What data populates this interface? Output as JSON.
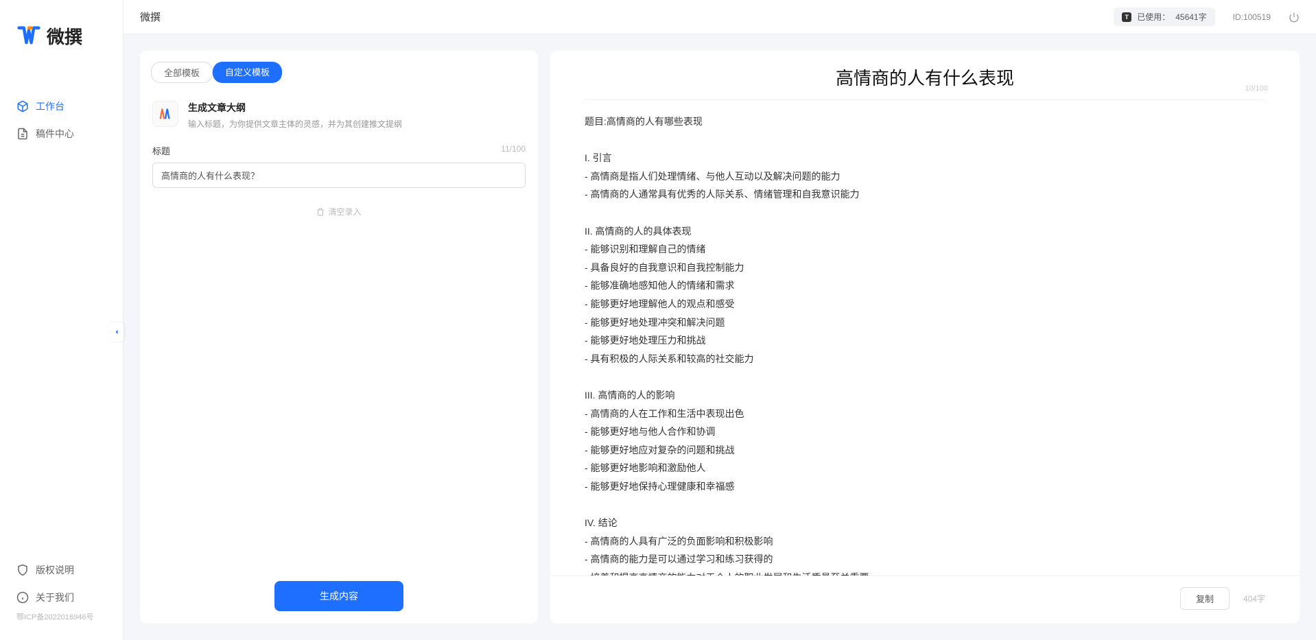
{
  "brand": {
    "name": "微撰"
  },
  "sidebar": {
    "nav": [
      {
        "label": "工作台",
        "active": true
      },
      {
        "label": "稿件中心",
        "active": false
      }
    ],
    "bottom": [
      {
        "label": "版权说明"
      },
      {
        "label": "关于我们"
      }
    ],
    "icp": "鄂ICP备2022016946号"
  },
  "header": {
    "title": "微撰",
    "usage_prefix": "已使用：",
    "usage_value": "45641字",
    "id_label": "ID:100519"
  },
  "left": {
    "tabs": [
      {
        "label": "全部模板",
        "active": false
      },
      {
        "label": "自定义模板",
        "active": true
      }
    ],
    "template": {
      "title": "生成文章大纲",
      "desc": "输入标题，为你提供文章主体的灵感，并为其创建推文提纲"
    },
    "form": {
      "label": "标题",
      "counter": "11/100",
      "value": "高情商的人有什么表现？",
      "clear": "清空录入"
    },
    "submit": "生成内容"
  },
  "right": {
    "title": "高情商的人有什么表现",
    "title_counter": "10/100",
    "body": "题目:高情商的人有哪些表现\n\nI. 引言\n- 高情商是指人们处理情绪、与他人互动以及解决问题的能力\n- 高情商的人通常具有优秀的人际关系、情绪管理和自我意识能力\n\nII. 高情商的人的具体表现\n- 能够识别和理解自己的情绪\n- 具备良好的自我意识和自我控制能力\n- 能够准确地感知他人的情绪和需求\n- 能够更好地理解他人的观点和感受\n- 能够更好地处理冲突和解决问题\n- 能够更好地处理压力和挑战\n- 具有积极的人际关系和较高的社交能力\n\nIII. 高情商的人的影响\n- 高情商的人在工作和生活中表现出色\n- 能够更好地与他人合作和协调\n- 能够更好地应对复杂的问题和挑战\n- 能够更好地影响和激励他人\n- 能够更好地保持心理健康和幸福感\n\nIV. 结论\n- 高情商的人具有广泛的负面影响和积极影响\n- 高情商的能力是可以通过学习和练习获得的\n- 培养和提高高情商的能力对于个人的职业发展和生活质量至关重要。",
    "copy": "复制",
    "word_count": "404字"
  }
}
